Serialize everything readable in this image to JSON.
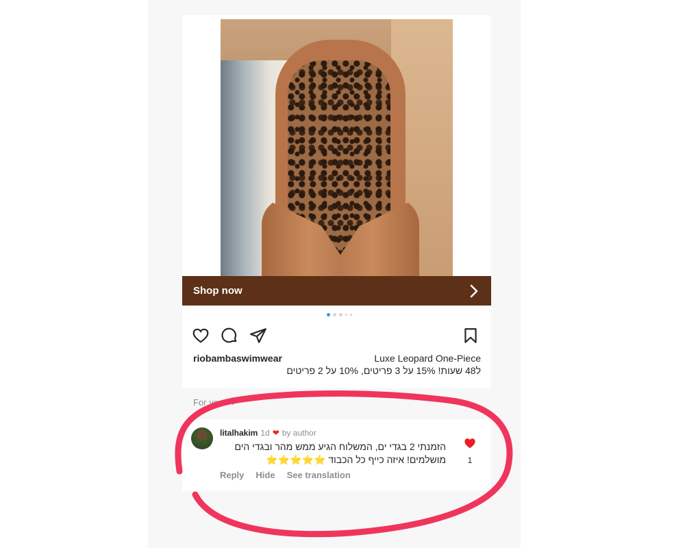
{
  "post": {
    "shop_label": "Shop now",
    "media_count": 5,
    "active_media_index": 0,
    "username": "riobambaswimwear",
    "product_name": "Luxe Leopard One-Piece",
    "promo_text": "ל48 שעות! 15% על 3 פריטים, 10% על 2 פריטים"
  },
  "actions": {
    "like_icon": "heart-outline-icon",
    "comment_icon": "comment-bubble-icon",
    "share_icon": "send-paper-plane-icon",
    "save_icon": "bookmark-icon"
  },
  "comments_section": {
    "filter_label": "For you"
  },
  "comment": {
    "user": "litalhakim",
    "age": "1d",
    "author_badge": "by author",
    "text": "הזמנתי 2 בגדי ים, המשלוח הגיע ממש מהר ובגדי הים מושלמים! איזה כייף כל הכבוד ⭐️⭐️⭐️⭐️⭐️",
    "like_count": "1",
    "reply_label": "Reply",
    "hide_label": "Hide",
    "translate_label": "See translation"
  },
  "colors": {
    "shop_bar": "#5d3018",
    "like_red": "#ed1c24",
    "annotation_circle": "#f0355c",
    "active_dot": "#3897f0"
  }
}
